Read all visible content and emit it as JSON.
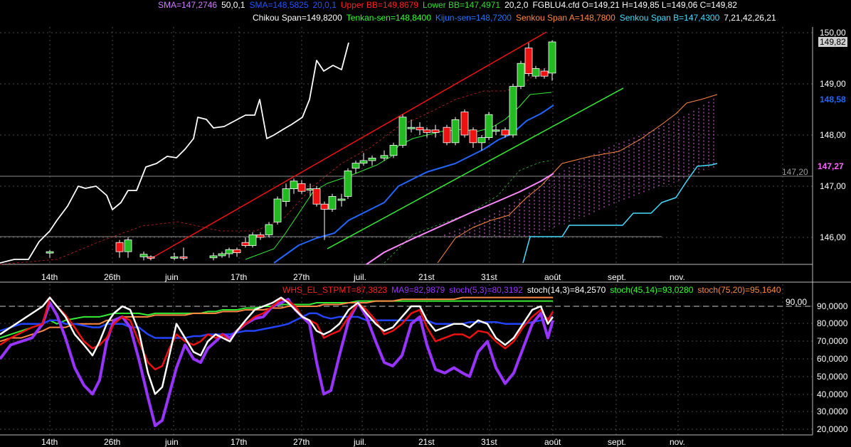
{
  "header": {
    "row1": [
      {
        "text": "SMA=147,2746",
        "color": "#d07cff"
      },
      {
        "text": "50,0,1",
        "color": "#ffffff"
      },
      {
        "text": "SMA=148,5825",
        "color": "#2255ff"
      },
      {
        "text": "20,0,1",
        "color": "#2255ff"
      },
      {
        "text": "Upper BB=149,8679",
        "color": "#ff2020"
      },
      {
        "text": "Lower BB=147,4971",
        "color": "#33dd33"
      },
      {
        "text": "20,2,0",
        "color": "#ffffff"
      },
      {
        "text": "FGBLU4.cfd O=149,21 H=149,85 L=149,06 C=149,82",
        "color": "#ffffff"
      }
    ],
    "row2": [
      {
        "text": "Chikou Span=149,8200",
        "color": "#ffffff"
      },
      {
        "text": "Tenkan-sen=148,8400",
        "color": "#33ff33"
      },
      {
        "text": "Kijun-sen=148,7200",
        "color": "#2277ff"
      },
      {
        "text": "Senkou Span A=148,7800",
        "color": "#ff8844"
      },
      {
        "text": "Senkou Span B=147,4300",
        "color": "#44ddff"
      },
      {
        "text": "7,21,42,26,21",
        "color": "#ffffff"
      }
    ]
  },
  "osc_header": [
    {
      "text": "WHS_EL_STPMT=87,3823",
      "color": "#ff2020"
    },
    {
      "text": "MA9=82,9879",
      "color": "#9933ff"
    },
    {
      "text": "stoch(5,3)=80,3192",
      "color": "#9933ff"
    },
    {
      "text": "stoch(14,3)=84,2570",
      "color": "#ffffff"
    },
    {
      "text": "stoch(45,14)=93,0280",
      "color": "#33ff33"
    },
    {
      "text": "stoch(75,20)=95,1640",
      "color": "#ff8844"
    }
  ],
  "price_axis": [
    "150,00",
    "149,00",
    "148,00",
    "147,00",
    "146,00"
  ],
  "price_tags": {
    "last": "149,82",
    "kijun": "148,58",
    "senkou_b": "147,27",
    "hline": "147,20"
  },
  "osc_axis": [
    "90,0000",
    "80,0000",
    "70,0000",
    "60,0000",
    "50,0000",
    "40,0000",
    "30,0000",
    "20,0000"
  ],
  "osc_level": "90,00",
  "x_axis": [
    "14th",
    "26th",
    "juin",
    "17th",
    "27th",
    "juil.",
    "21st",
    "31st",
    "août",
    "sept.",
    "nov."
  ],
  "colors": {
    "background": "#000000",
    "grid": "#4a4a4a",
    "bull": "#22bb22",
    "bear": "#ee1111"
  }
}
